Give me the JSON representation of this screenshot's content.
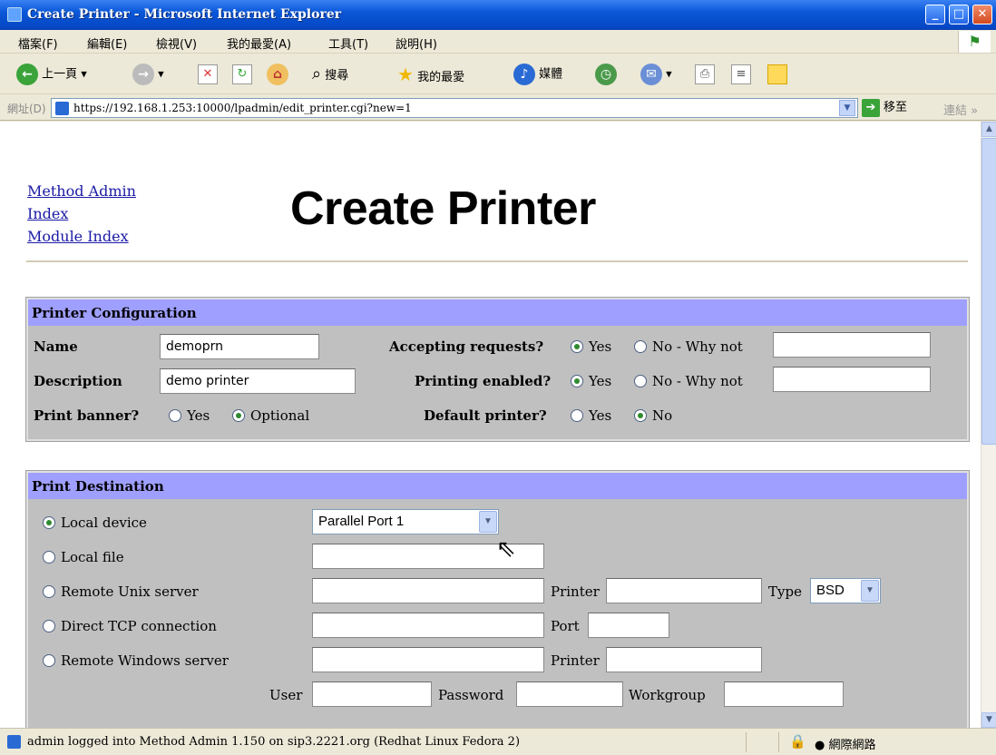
{
  "window": {
    "title": "Create Printer - Microsoft Internet Explorer"
  },
  "menu": [
    "檔案(F)",
    "編輯(E)",
    "檢視(V)",
    "我的最愛(A)",
    "工具(T)",
    "說明(H)"
  ],
  "toolbar": {
    "back": "上一頁",
    "search": "搜尋",
    "favorites": "我的最愛",
    "media": "媒體"
  },
  "address": {
    "label": "網址(D)",
    "url": "https://192.168.1.253:10000/lpadmin/edit_printer.cgi?new=1",
    "go": "移至",
    "links": "連結"
  },
  "nav_links": [
    "Method Admin",
    "Index",
    "Module Index"
  ],
  "page_title": "Create Printer",
  "printer_config": {
    "header": "Printer Configuration",
    "name_label": "Name",
    "name_value": "demoprn",
    "desc_label": "Description",
    "desc_value": "demo printer",
    "banner_label": "Print banner?",
    "banner_yes": "Yes",
    "banner_optional": "Optional",
    "accepting_label": "Accepting requests?",
    "printing_label": "Printing enabled?",
    "default_label": "Default printer?",
    "yes": "Yes",
    "no_why": "No - Why not",
    "no": "No"
  },
  "print_dest": {
    "header": "Print Destination",
    "local_device": "Local device",
    "local_device_value": "Parallel Port 1",
    "local_file": "Local file",
    "remote_unix": "Remote Unix server",
    "printer_label": "Printer",
    "type_label": "Type",
    "type_value": "BSD",
    "direct_tcp": "Direct TCP connection",
    "port_label": "Port",
    "remote_windows": "Remote Windows server",
    "user_label": "User",
    "password_label": "Password",
    "workgroup_label": "Workgroup"
  },
  "status": {
    "text": "admin logged into Method Admin 1.150 on sip3.2221.org (Redhat Linux Fedora 2)",
    "zone": "網際網路"
  }
}
